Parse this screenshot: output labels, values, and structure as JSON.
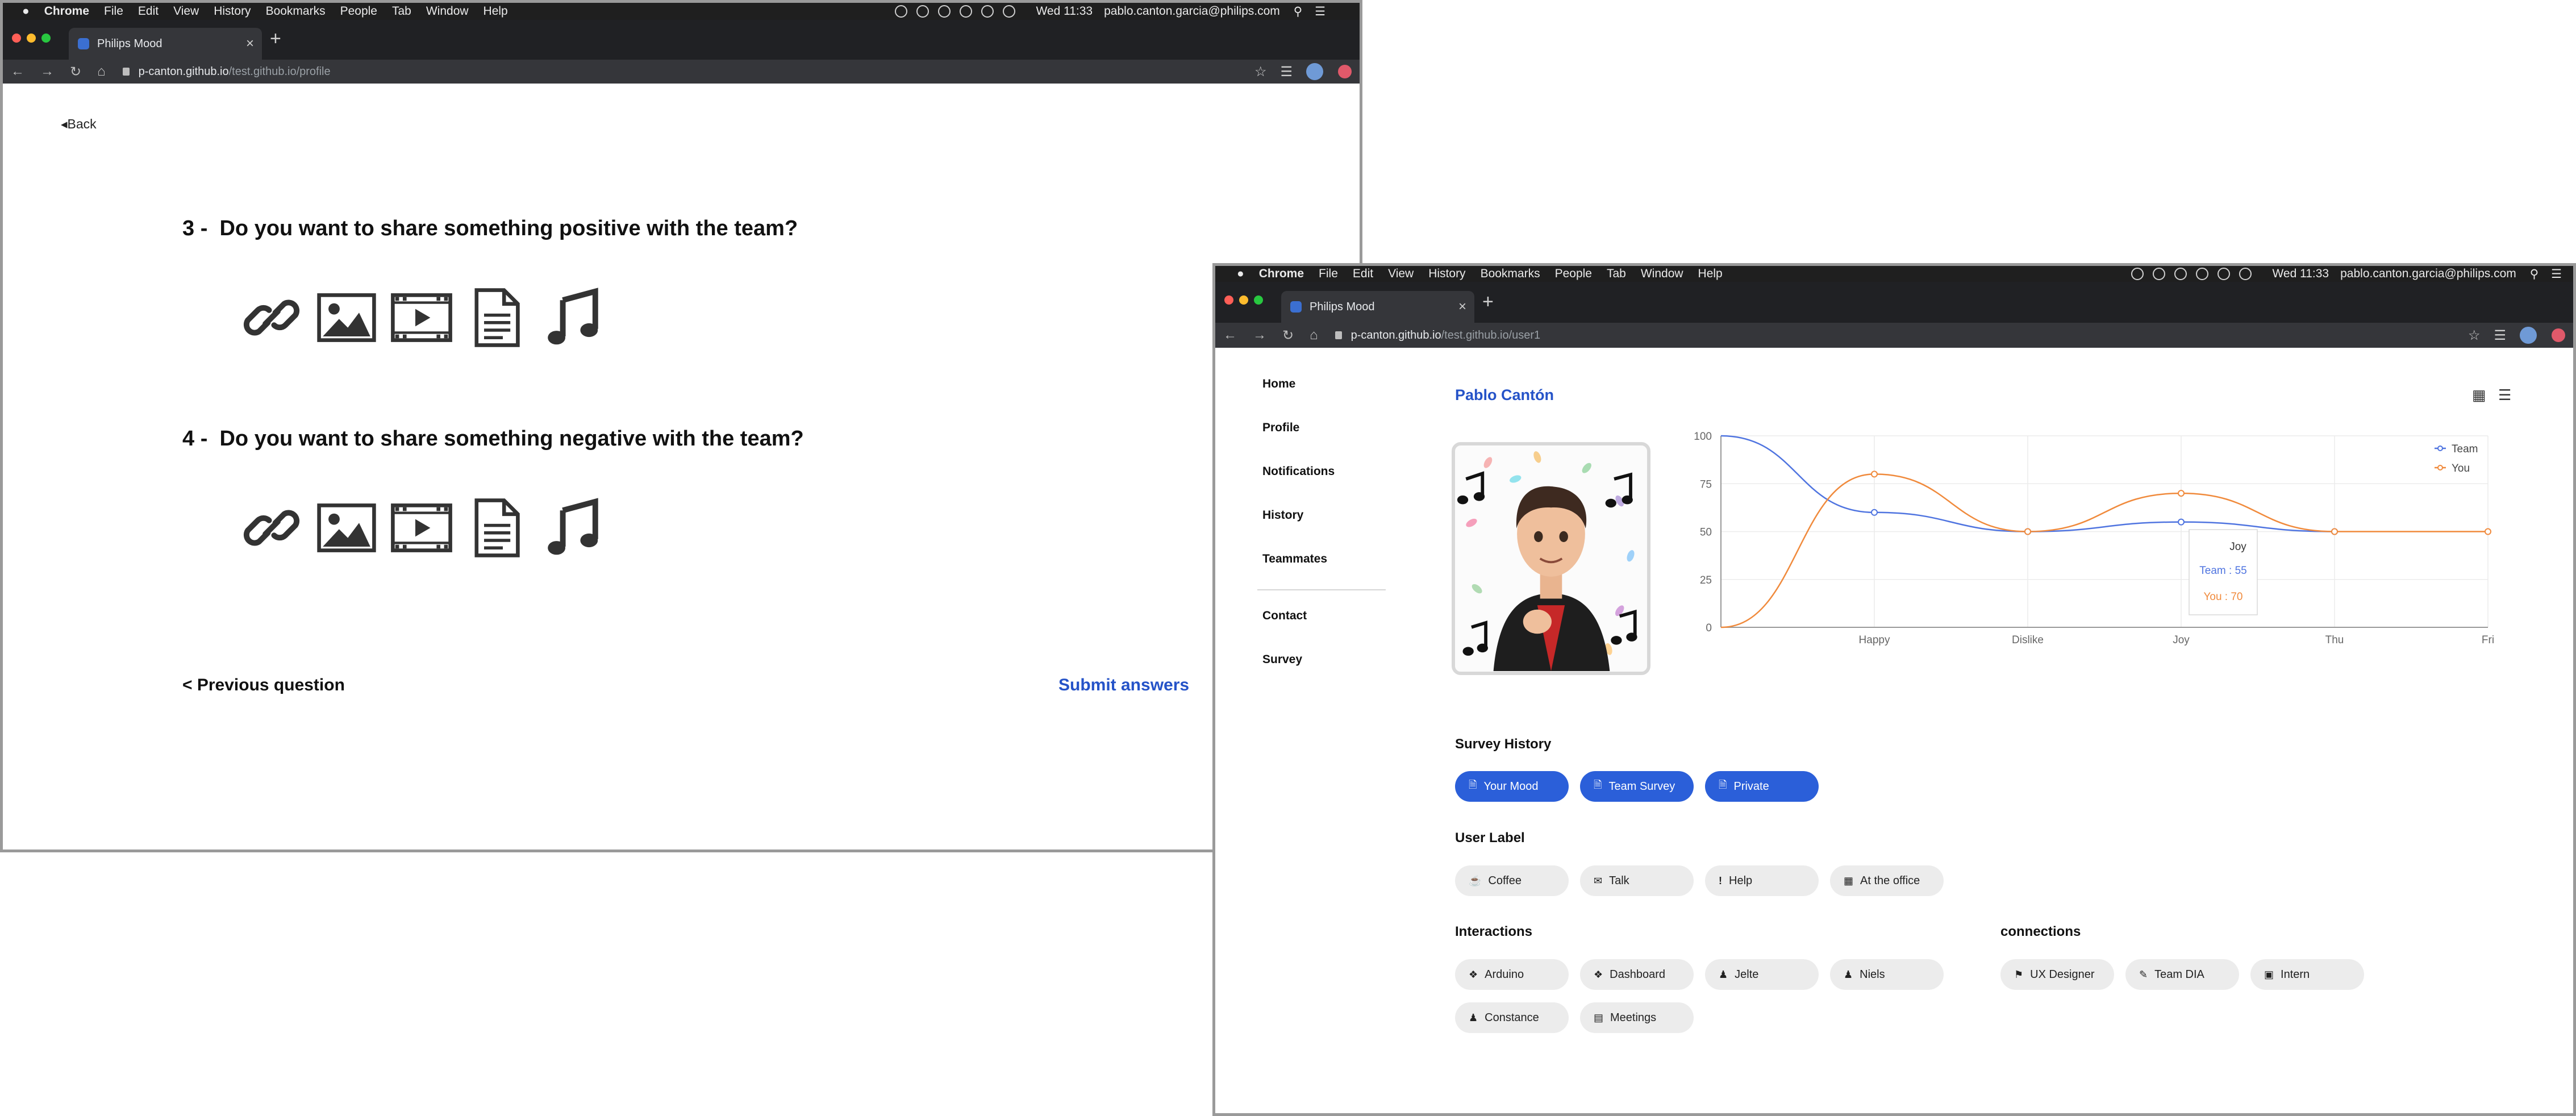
{
  "window1": {
    "menubar": {
      "app": "Chrome",
      "items": [
        "File",
        "Edit",
        "View",
        "History",
        "Bookmarks",
        "People",
        "Tab",
        "Window",
        "Help"
      ],
      "clock": "Wed 11:33",
      "account": "pablo.canton.garcia@philips.com"
    },
    "tab_title": "Philips Mood",
    "url_host": "p-canton.github.io",
    "url_path": "/test.github.io/profile",
    "back_label": "Back",
    "questions": [
      {
        "number": "3 -",
        "text": "Do you want to share something positive with the team?"
      },
      {
        "number": "4 -",
        "text": "Do you want to share something negative with the team?"
      }
    ],
    "media_icons": [
      "link-icon",
      "image-icon",
      "video-icon",
      "document-icon",
      "music-icon"
    ],
    "prev_label": "< Previous question",
    "submit_label": "Submit answers"
  },
  "window2": {
    "menubar": {
      "app": "Chrome",
      "items": [
        "File",
        "Edit",
        "View",
        "History",
        "Bookmarks",
        "People",
        "Tab",
        "Window",
        "Help"
      ],
      "clock": "Wed 11:33",
      "account": "pablo.canton.garcia@philips.com"
    },
    "tab_title": "Philips Mood",
    "url_host": "p-canton.github.io",
    "url_path": "/test.github.io/user1",
    "nav": [
      "Home",
      "Profile",
      "Notifications",
      "History",
      "Teammates",
      "Contact",
      "Survey"
    ],
    "user_name": "Pablo Cantón",
    "survey_history_title": "Survey History",
    "survey_buttons": [
      "Your Mood",
      "Team Survey",
      "Private"
    ],
    "user_label_title": "User Label",
    "user_labels": [
      {
        "icon": "coffee-icon",
        "label": "Coffee"
      },
      {
        "icon": "chat-icon",
        "label": "Talk"
      },
      {
        "icon": "exclamation-icon",
        "label": "Help"
      },
      {
        "icon": "building-icon",
        "label": "At the office"
      }
    ],
    "interactions_title": "Interactions",
    "interactions": [
      {
        "icon": "network-icon",
        "label": "Arduino"
      },
      {
        "icon": "network-icon",
        "label": "Dashboard"
      },
      {
        "icon": "person-icon",
        "label": "Jelte"
      },
      {
        "icon": "person-icon",
        "label": "Niels"
      },
      {
        "icon": "person-icon",
        "label": "Constance"
      },
      {
        "icon": "calendar-icon",
        "label": "Meetings"
      }
    ],
    "connections_title": "connections",
    "connections": [
      {
        "icon": "bookmark-icon",
        "label": "UX Designer"
      },
      {
        "icon": "brush-icon",
        "label": "Team DIA"
      },
      {
        "icon": "briefcase-icon",
        "label": "Intern"
      }
    ]
  },
  "chart_data": {
    "type": "line",
    "categories": [
      "",
      "Happy",
      "Dislike",
      "Joy",
      "Thu",
      "Fri"
    ],
    "series": [
      {
        "name": "Team",
        "color": "#4f74e0",
        "values": [
          100,
          60,
          50,
          55,
          50,
          null
        ]
      },
      {
        "name": "You",
        "color": "#f08a3c",
        "values": [
          0,
          80,
          50,
          70,
          50,
          50
        ]
      }
    ],
    "ylim": [
      0,
      100
    ],
    "yticks": [
      0,
      25,
      50,
      75,
      100
    ],
    "legend": "top-right",
    "grid": true,
    "tooltip": {
      "title": "Joy",
      "lines": [
        "Team : 55",
        "You : 70"
      ]
    }
  }
}
